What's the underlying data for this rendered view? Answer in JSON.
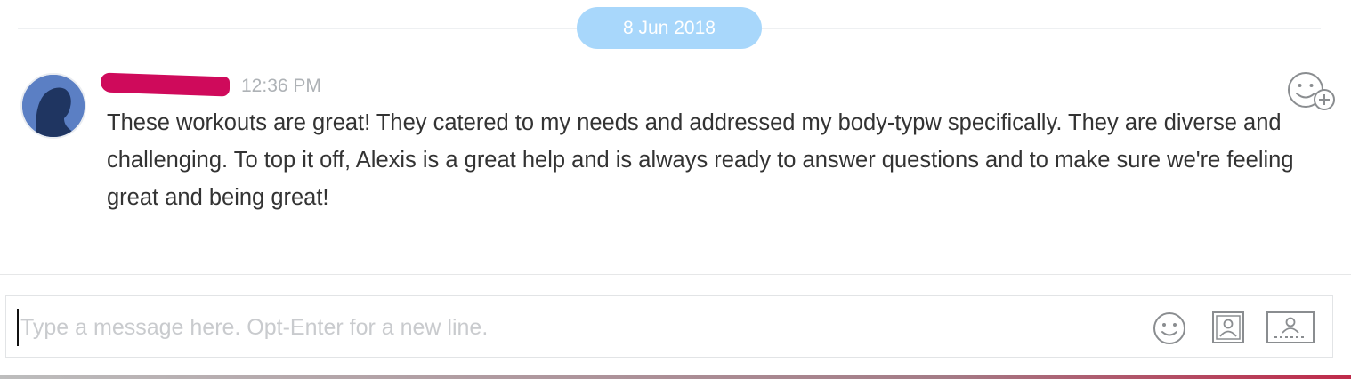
{
  "date_separator": {
    "label": "8 Jun 2018"
  },
  "message": {
    "sender_name": "",
    "sender_redacted": true,
    "timestamp": "12:36 PM",
    "text": "These workouts are great! They catered to my needs and addressed my body-typw specifically. They are diverse and challenging. To top it off, Alexis is a great help and is always ready to answer questions and to make sure we're feeling great and being great!",
    "avatar_icon": "person-silhouette-avatar",
    "reaction_icon": "add-reaction-icon"
  },
  "composer": {
    "placeholder": "Type a message here. Opt-Enter for a new line.",
    "value": "",
    "icons": [
      "emoji-icon",
      "contact-card-icon",
      "share-contact-icon"
    ]
  },
  "colors": {
    "date_pill": "#a8d7fb",
    "redaction": "#cf0a5b",
    "message_text": "#333333",
    "timestamp": "#aeb2b6",
    "icon_gray": "#8a8d90"
  }
}
